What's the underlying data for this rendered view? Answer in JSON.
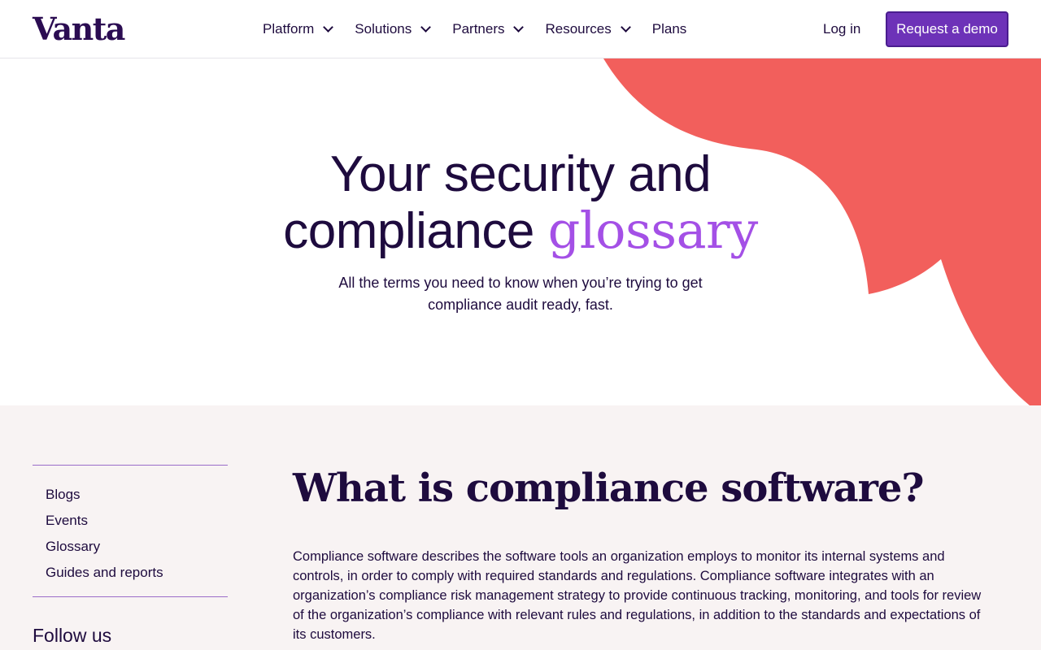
{
  "header": {
    "logo": "Vanta",
    "nav": [
      {
        "label": "Platform",
        "has_dropdown": true
      },
      {
        "label": "Solutions",
        "has_dropdown": true
      },
      {
        "label": "Partners",
        "has_dropdown": true
      },
      {
        "label": "Resources",
        "has_dropdown": true
      },
      {
        "label": "Plans",
        "has_dropdown": false
      }
    ],
    "login_label": "Log in",
    "demo_label": "Request a demo"
  },
  "hero": {
    "title_line1": "Your security and",
    "title_line2_plain": "compliance",
    "title_line2_accent": "glossary",
    "subtitle": "All the terms you need to know when you’re trying to get compliance audit ready, fast."
  },
  "sidebar": {
    "links": [
      "Blogs",
      "Events",
      "Glossary",
      "Guides and reports"
    ],
    "follow_label": "Follow us"
  },
  "article": {
    "title": "What is compliance software?",
    "body": "Compliance software describes the software tools an organization employs to monitor its internal systems and controls, in order to comply with required standards and regulations. Compliance software integrates with an organization’s compliance risk management strategy to provide continuous tracking, monitoring, and tools for review of the organization’s compliance with relevant rules and regulations, in addition to the standards and expectations of its customers."
  },
  "colors": {
    "brand_dark": "#1e0b3e",
    "accent_purple": "#a450e6",
    "button_purple": "#6d32b8",
    "blob_coral": "#f25f5c",
    "content_bg": "#f8f3f3"
  }
}
